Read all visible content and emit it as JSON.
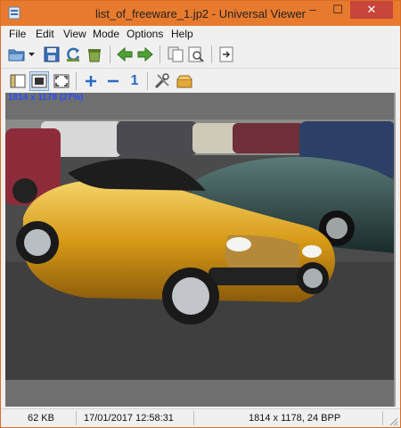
{
  "window": {
    "title": "list_of_freeware_1.jp2 - Universal Viewer",
    "icon": "universal-viewer-icon",
    "controls": {
      "minimize": "‒",
      "maximize": "☐",
      "close": "✕"
    }
  },
  "menu": [
    "File",
    "Edit",
    "View",
    "Mode",
    "Options",
    "Help"
  ],
  "toolbar1": {
    "buttons": [
      "open-icon",
      "dropdown-arrow-icon",
      "save-icon",
      "reload-icon",
      "recycle-bin-icon",
      "back-arrow-icon",
      "forward-arrow-icon",
      "copy-icon",
      "print-preview-icon",
      "exit-icon"
    ]
  },
  "toolbar2": {
    "buttons": [
      "panel-icon",
      "fit-window-icon",
      "fullscreen-icon",
      "zoom-in-icon",
      "zoom-out-icon",
      "original-size-icon",
      "tools-icon",
      "plugins-icon"
    ],
    "original_size_label": "1"
  },
  "viewer": {
    "dimensions_label": "1814 x 1178 (27%)",
    "image_subject": "gold roadster in parking lot photo"
  },
  "status": {
    "size": "62 KB",
    "date": "17/01/2017 12:58:31",
    "info": "1814 x 1178, 24 BPP"
  },
  "colors": {
    "titlebar": "#e87a2e",
    "close_button": "#c7453a",
    "dimension_text": "#2a4dff",
    "viewport_bg": "#6f6f6f"
  }
}
